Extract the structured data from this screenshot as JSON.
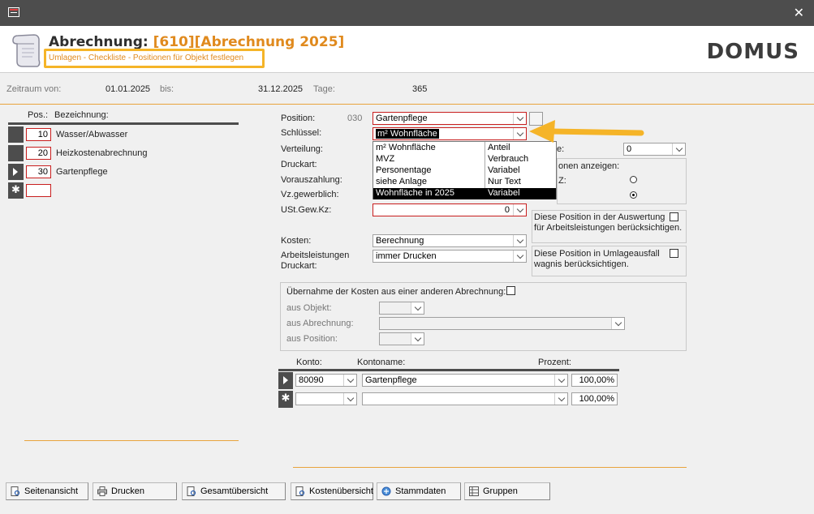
{
  "window": {
    "close_glyph": "✕"
  },
  "header": {
    "title_prefix": "Abrechnung: ",
    "title_accent": "[610][Abrechnung 2025]",
    "subtitle": "Umlagen - Checkliste - Positionen für Objekt festlegen",
    "logo": "DOMUS"
  },
  "period": {
    "from_label": "Zeitraum von:",
    "from_value": "01.01.2025",
    "to_label": "bis:",
    "to_value": "31.12.2025",
    "days_label": "Tage:",
    "days_value": "365"
  },
  "positions_list": {
    "col_pos": "Pos.:",
    "col_name": "Bezeichnung:",
    "rows": [
      {
        "pos": "10",
        "name": "Wasser/Abwasser"
      },
      {
        "pos": "20",
        "name": "Heizkostenabrechnung"
      },
      {
        "pos": "30",
        "name": "Gartenpflege"
      }
    ],
    "new_glyph": "✱"
  },
  "form": {
    "position_label": "Position:",
    "position_num": "030",
    "position_value": "Gartenpflege",
    "schluessel_label": "Schlüssel:",
    "schluessel_value": "m² Wohnfläche",
    "verteilung_label": "Verteilung:",
    "druckart_label": "Druckart:",
    "vorauszahlung_label": "Vorauszahlung:",
    "vzgewerblich_label": "Vz.gewerblich:",
    "ustgewkz_label": "USt.Gew.Kz:",
    "ustgewkz_value": "0",
    "kosten_label": "Kosten:",
    "kosten_value": "Berechnung",
    "arbeitsleistungen_label": "Arbeitsleistungen",
    "arbeitsleistungen_label2": "Druckart:",
    "arbeitsleistungen_value": "immer Drucken"
  },
  "schluessel_dropdown": {
    "options": [
      {
        "name": "m² Wohnfläche",
        "type": "Anteil"
      },
      {
        "name": "MVZ",
        "type": "Verbrauch"
      },
      {
        "name": "Personentage",
        "type": "Variabel"
      },
      {
        "name": "siehe Anlage",
        "type": "Nur Text"
      },
      {
        "name": "Wohnfläche in 2025",
        "type": "Variabel"
      }
    ]
  },
  "right_panel": {
    "partial_label": "e:",
    "partial_value": "0",
    "anzeigen_label": "onen anzeigen:",
    "radio1_label": "Z:",
    "auswertung_line1": "Diese Position in der Auswertung",
    "auswertung_line2": "für Arbeitsleistungen berücksichtigen.",
    "umlageausfall_line1": "Diese Position in Umlageausfall",
    "umlageausfall_line2": "wagnis berücksichtigen."
  },
  "uebernahme": {
    "title": "Übernahme der Kosten aus einer anderen Abrechnung:",
    "objekt_label": "aus Objekt:",
    "abrechnung_label": "aus Abrechnung:",
    "position_label": "aus Position:"
  },
  "konto": {
    "col_konto": "Konto:",
    "col_kontoname": "Kontoname:",
    "col_prozent": "Prozent:",
    "rows": [
      {
        "konto": "80090",
        "name": "Gartenpflege",
        "prozent": "100,00%"
      },
      {
        "konto": "",
        "name": "",
        "prozent": "100,00%"
      }
    ],
    "new_glyph": "✱"
  },
  "buttons": [
    {
      "label": "Seitenansicht",
      "icon": "page-view-icon"
    },
    {
      "label": "Drucken",
      "icon": "printer-icon"
    },
    {
      "label": "Gesamtübersicht",
      "icon": "overview-icon"
    },
    {
      "label": "Kostenübersicht",
      "icon": "cost-overview-icon"
    },
    {
      "label": "Stammdaten",
      "icon": "master-data-icon"
    },
    {
      "label": "Gruppen",
      "icon": "groups-icon"
    }
  ],
  "colors": {
    "accent": "#e08a1e",
    "highlight": "#f5b428",
    "error_border": "#c81e1e"
  }
}
